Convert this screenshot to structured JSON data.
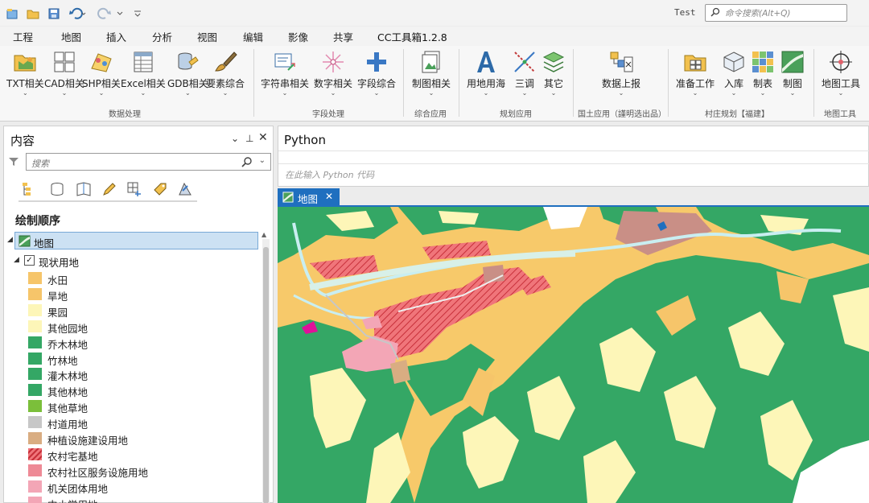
{
  "titlebar": {
    "project_name": "Test",
    "command_search_placeholder": "命令搜索(Alt+Q)"
  },
  "ribbon_tabs": [
    "工程",
    "地图",
    "插入",
    "分析",
    "视图",
    "编辑",
    "影像",
    "共享",
    "CC工具箱1.2.8"
  ],
  "active_tab": "CC工具箱1.2.8",
  "ribbon": {
    "buttons": {
      "txt": "TXT相关",
      "cad": "CAD相关",
      "shp": "SHP相关",
      "excel": "Excel相关",
      "gdb": "GDB相关",
      "feature": "要素综合",
      "string": "字符串相关",
      "number": "数字相关",
      "field": "字段综合",
      "mapping": "制图相关",
      "landuse": "用地用海",
      "survey": "三调",
      "other": "其它",
      "report": "数据上报",
      "prepare": "准备工作",
      "import": "入库",
      "tabulate": "制表",
      "draw": "制图",
      "maptools": "地图工具"
    },
    "groups": {
      "data": "数据处理",
      "field": "字段处理",
      "general": "综合应用",
      "planning": "规划应用",
      "landres": "国土应用（謹明选出品）",
      "village": "村庄规划【福建】",
      "maptools": "地图工具"
    }
  },
  "contents": {
    "title": "内容",
    "search_placeholder": "搜索",
    "drawing_order": "绘制顺序",
    "map_node": "地图",
    "layer_name": "现状用地",
    "legend": [
      {
        "label": "水田",
        "color": "#f6c56a",
        "hatch": false
      },
      {
        "label": "旱地",
        "color": "#f6c56a",
        "hatch": false
      },
      {
        "label": "果园",
        "color": "#fdf6b8",
        "hatch": false
      },
      {
        "label": "其他园地",
        "color": "#fdf6b8",
        "hatch": false
      },
      {
        "label": "乔木林地",
        "color": "#34a765",
        "hatch": false
      },
      {
        "label": "竹林地",
        "color": "#34a765",
        "hatch": false
      },
      {
        "label": "灌木林地",
        "color": "#34a765",
        "hatch": false
      },
      {
        "label": "其他林地",
        "color": "#34a765",
        "hatch": false
      },
      {
        "label": "其他草地",
        "color": "#7bbf3a",
        "hatch": false
      },
      {
        "label": "村道用地",
        "color": "#c7c7c7",
        "hatch": false
      },
      {
        "label": "种植设施建设用地",
        "color": "#d9ad82",
        "hatch": false
      },
      {
        "label": "农村宅基地",
        "color": "#f0757a",
        "hatch": true
      },
      {
        "label": "农村社区服务设施用地",
        "color": "#ee8a96",
        "hatch": false
      },
      {
        "label": "机关团体用地",
        "color": "#f3a6b6",
        "hatch": false
      },
      {
        "label": "中小学用地",
        "color": "#f3a6b6",
        "hatch": false
      }
    ]
  },
  "python": {
    "title": "Python",
    "placeholder": "在此输入 Python 代码"
  },
  "map": {
    "tab_label": "地图",
    "colors": {
      "forest": "#34a765",
      "farmland": "#f6c56a",
      "orchard": "#fdf6b8",
      "residential": "#f0757a",
      "water": "#c9eef1",
      "road": "#c7c7c7",
      "facility": "#d9ad82",
      "public": "#f3a6b6",
      "magenta": "#e0109a",
      "grass": "#7bbf3a",
      "unused": "#ffffff"
    }
  }
}
